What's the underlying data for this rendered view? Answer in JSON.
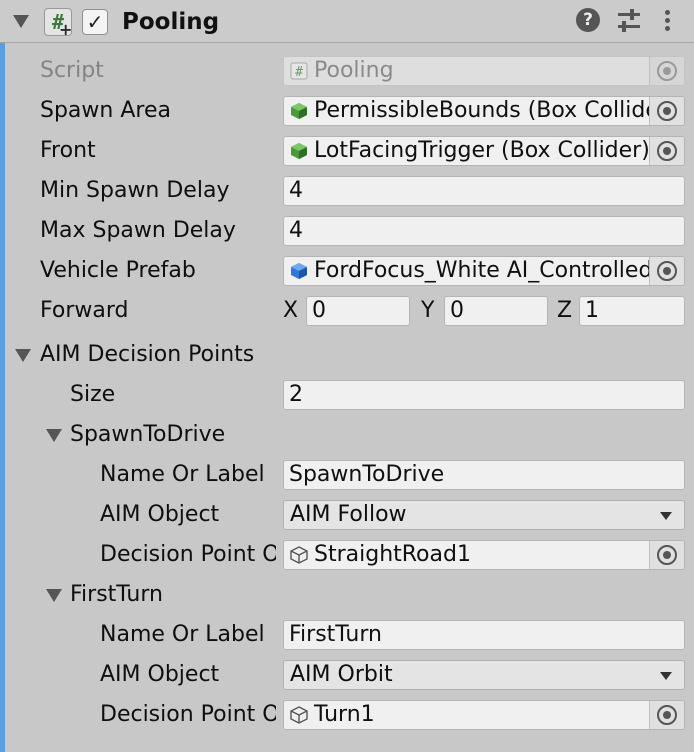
{
  "header": {
    "title": "Pooling",
    "enabled": true,
    "script_icon_glyph": "#",
    "help_icon_glyph": "?"
  },
  "fields": {
    "script": {
      "label": "Script",
      "value": "Pooling",
      "icon": "script-icon"
    },
    "spawn_area": {
      "label": "Spawn Area",
      "value": "PermissibleBounds (Box Collider)",
      "icon": "box-collider-icon"
    },
    "front": {
      "label": "Front",
      "value": "LotFacingTrigger (Box Collider)",
      "icon": "box-collider-icon"
    },
    "min_spawn_delay": {
      "label": "Min Spawn Delay",
      "value": "4"
    },
    "max_spawn_delay": {
      "label": "Max Spawn Delay",
      "value": "4"
    },
    "vehicle_prefab": {
      "label": "Vehicle Prefab",
      "value": "FordFocus_White AI_Controlled",
      "icon": "prefab-icon"
    },
    "forward": {
      "label": "Forward",
      "x_label": "X",
      "x": "0",
      "y_label": "Y",
      "y": "0",
      "z_label": "Z",
      "z": "1"
    }
  },
  "aim_decision_points": {
    "label": "AIM Decision Points",
    "size_label": "Size",
    "size": "2",
    "elements": [
      {
        "title": "SpawnToDrive",
        "name_label": "Name Or Label",
        "name_value": "SpawnToDrive",
        "aim_object_label": "AIM Object",
        "aim_object_value": "AIM Follow",
        "decision_point_label": "Decision Point Object",
        "decision_point_value": "StraightRoad1"
      },
      {
        "title": "FirstTurn",
        "name_label": "Name Or Label",
        "name_value": "FirstTurn",
        "aim_object_label": "AIM Object",
        "aim_object_value": "AIM Orbit",
        "decision_point_label": "Decision Point Object",
        "decision_point_value": "Turn1"
      }
    ]
  },
  "colors": {
    "panel_bg": "#c8c8c8",
    "field_bg": "#f0f0f0",
    "accent_bar": "#5aa0e0",
    "collider_icon": "#4a9a3c",
    "prefab_icon": "#2f78d8"
  }
}
